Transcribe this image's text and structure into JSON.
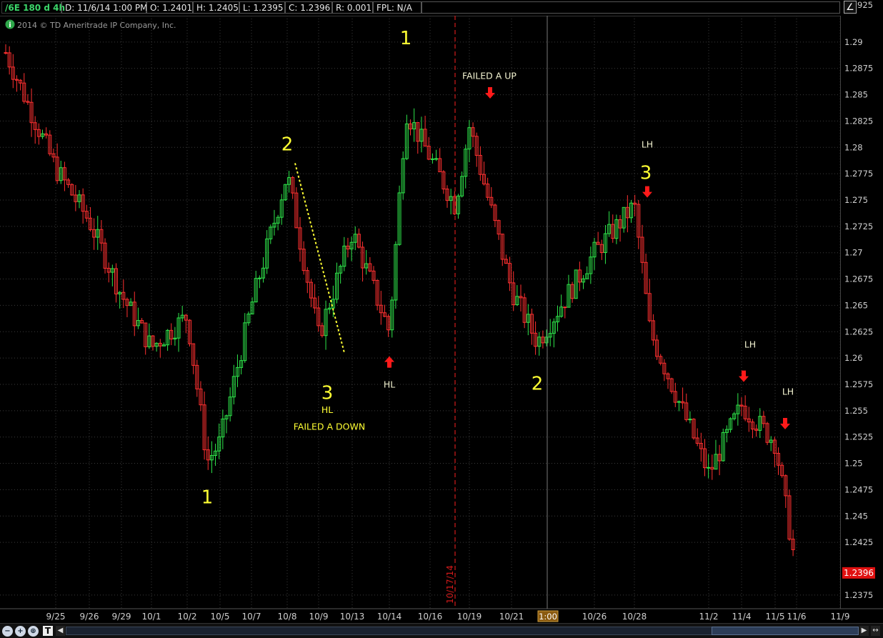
{
  "header": {
    "symbol": "/6E 180 d 4h",
    "date": "D: 11/6/14 1:00 PM",
    "open": "O: 1.2401",
    "high": "H: 1.2405",
    "low": "L: 1.2395",
    "close": "C: 1.2396",
    "range": "R: 0.001",
    "fpl": "FPL: N/A",
    "copyright": "2014 © TD Ameritrade IP Company, Inc.",
    "info_icon": "info-icon",
    "tool_icon": "drawing-tool-icon"
  },
  "colors": {
    "up": "#2ee54a",
    "down": "#ff3030",
    "annotation": "#ffff33",
    "arrow": "#ff1a1a",
    "grid": "#3c3c3c",
    "price_badge": "#e01010"
  },
  "chart_data": {
    "type": "candlestick",
    "ylim": [
      1.2362,
      1.2925
    ],
    "yticks": [
      "1.29",
      "1.2875",
      "1.285",
      "1.2825",
      "1.28",
      "1.2775",
      "1.275",
      "1.2725",
      "1.27",
      "1.2675",
      "1.265",
      "1.2625",
      "1.26",
      "1.2575",
      "1.255",
      "1.2525",
      "1.25",
      "1.2475",
      "1.245",
      "1.2425",
      "1.2375"
    ],
    "top_tick": "925",
    "last_price": "1.2396",
    "xlabels": [
      "9/25",
      "9/26",
      "9/29",
      "10/1",
      "10/2",
      "10/5",
      "10/7",
      "10/8",
      "10/9",
      "10/13",
      "10/14",
      "10/16",
      "10/19",
      "10/21",
      "10/26",
      "10/28",
      "11/2",
      "11/4",
      "11/5",
      "11/6",
      "11/9"
    ],
    "cursor_time": "1:00",
    "vline_label": "10/17/14",
    "key_closes": [
      [
        "9/24",
        1.289
      ],
      [
        "9/25",
        1.278
      ],
      [
        "9/26",
        1.273
      ],
      [
        "9/29",
        1.266
      ],
      [
        "10/1",
        1.261
      ],
      [
        "10/2",
        1.264
      ],
      [
        "10/3",
        1.2502
      ],
      [
        "10/5",
        1.252
      ],
      [
        "10/7",
        1.265
      ],
      [
        "10/8",
        1.2775
      ],
      [
        "10/9",
        1.262
      ],
      [
        "10/13",
        1.272
      ],
      [
        "10/14",
        1.2625
      ],
      [
        "10/15",
        1.2835
      ],
      [
        "10/17",
        1.2745
      ],
      [
        "10/19",
        1.282
      ],
      [
        "10/21",
        1.2665
      ],
      [
        "10/22",
        1.2615
      ],
      [
        "10/26",
        1.27
      ],
      [
        "10/28",
        1.2745
      ],
      [
        "10/29",
        1.2625
      ],
      [
        "11/2",
        1.249
      ],
      [
        "11/4",
        1.2555
      ],
      [
        "11/5",
        1.252
      ],
      [
        "11/6",
        1.2396
      ]
    ],
    "annotations": [
      {
        "text": "1",
        "date": "10/3",
        "price": 1.2462
      },
      {
        "text": "2",
        "date": "10/8",
        "price": 1.2797
      },
      {
        "text": "3",
        "date": "10/9",
        "price": 1.2561
      },
      {
        "text": "HL",
        "date": "10/9",
        "price": 1.2548
      },
      {
        "text": "FAILED A DOWN",
        "date": "10/9",
        "price": 1.2532
      },
      {
        "text": "HL",
        "date": "10/14",
        "price": 1.2572
      },
      {
        "text": "1",
        "date": "10/15",
        "price": 1.2898
      },
      {
        "text": "FAILED A UP",
        "date": "10/19",
        "price": 1.2865
      },
      {
        "text": "2",
        "date": "10/22",
        "price": 1.257
      },
      {
        "text": "LH",
        "date": "10/28",
        "price": 1.28
      },
      {
        "text": "3",
        "date": "10/28",
        "price": 1.277
      },
      {
        "text": "LH",
        "date": "11/4",
        "price": 1.261
      },
      {
        "text": "LH",
        "date": "11/5",
        "price": 1.2565
      }
    ]
  }
}
